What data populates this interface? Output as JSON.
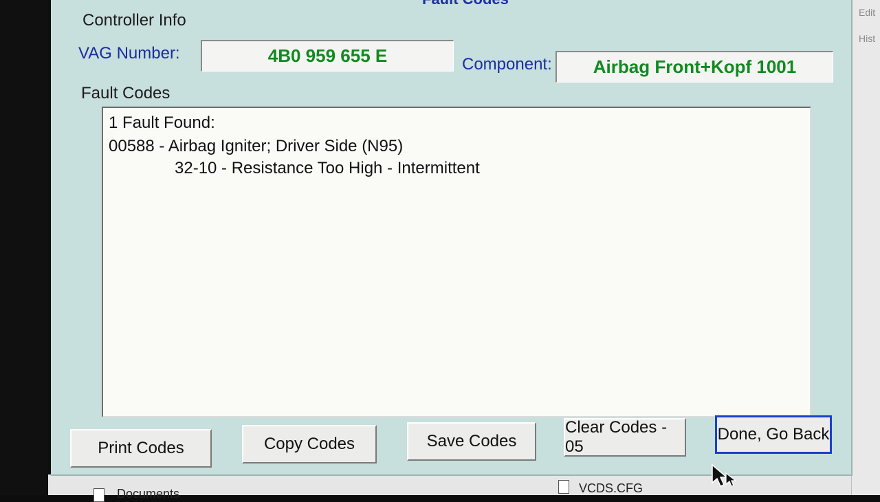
{
  "dialog": {
    "title": "Fault Codes",
    "controller_info_label": "Controller Info",
    "vag_number_label": "VAG Number:",
    "vag_number_value": "4B0 959 655 E",
    "component_label": "Component:",
    "component_value": "Airbag Front+Kopf  1001",
    "fault_codes_label": "Fault Codes",
    "fault_lines": [
      "1 Fault Found:",
      "00588 - Airbag Igniter; Driver Side (N95)",
      "32-10 - Resistance Too High - Intermittent"
    ],
    "buttons": {
      "print": "Print Codes",
      "copy": "Copy Codes",
      "save": "Save Codes",
      "clear": "Clear Codes - 05",
      "done": "Done, Go Back"
    },
    "colors": {
      "background": "#c7dfdd",
      "label_blue": "#1a2da0",
      "value_green": "#118a20",
      "default_button_outline": "#1a3fd0"
    }
  },
  "background_window": {
    "menu_items": [
      "Edit",
      "Hist"
    ]
  },
  "desktop": {
    "items": [
      "Documents",
      "VCDS.CFG"
    ]
  }
}
